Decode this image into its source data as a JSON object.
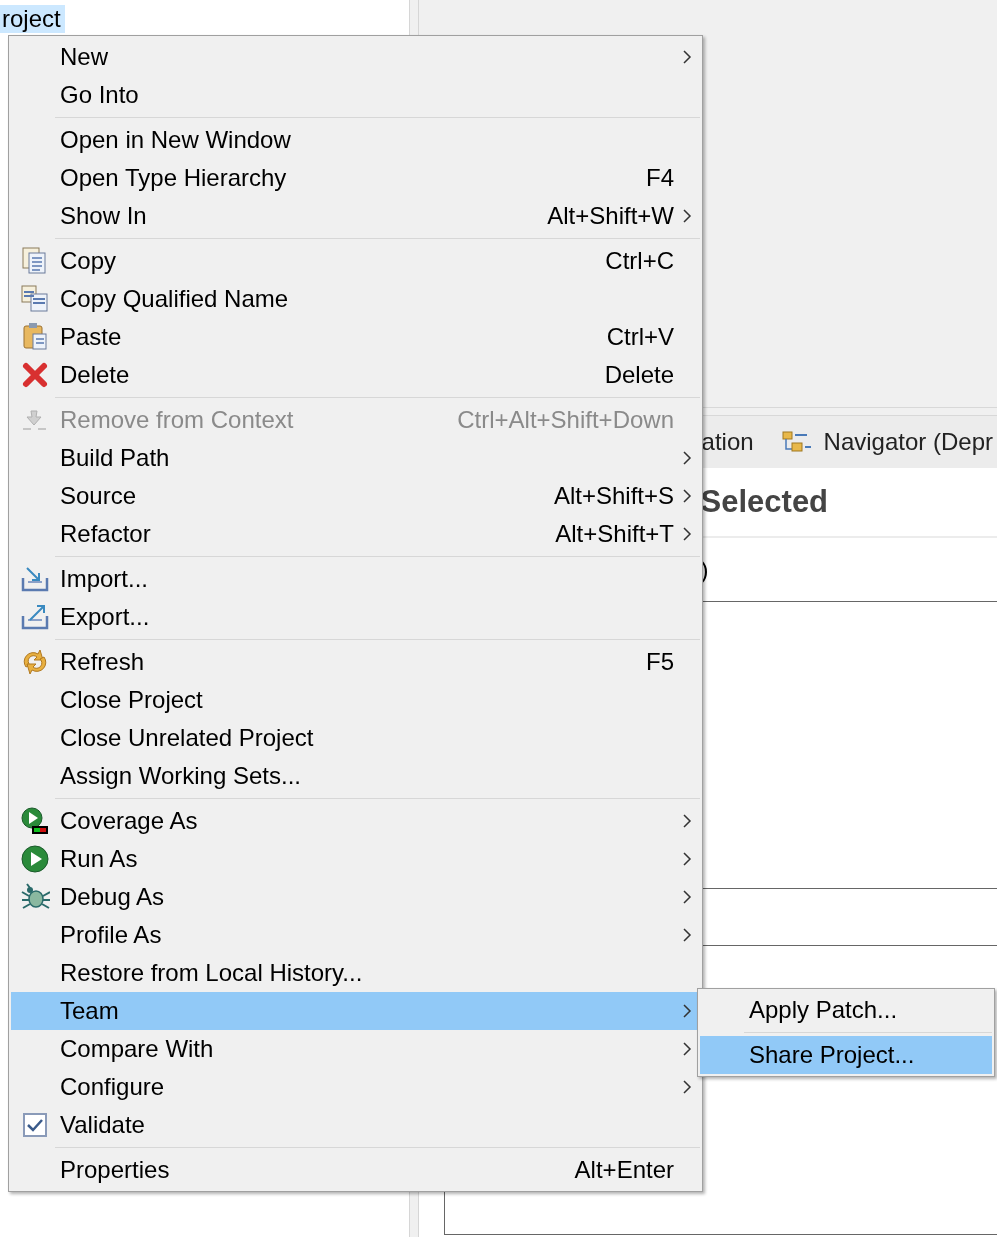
{
  "explorer": {
    "selected_item": {
      "label": "roject",
      "selected": true
    }
  },
  "editor": {
    "tabs": [
      {
        "label": "ation",
        "icon": false,
        "selected": false
      },
      {
        "label": "Navigator (Depr",
        "icon": true,
        "selected": false
      }
    ],
    "heading": "Selected",
    "line": ")"
  },
  "context_menu": {
    "groups": [
      [
        {
          "label": "New",
          "submenu": true
        },
        {
          "label": "Go Into"
        }
      ],
      [
        {
          "label": "Open in New Window"
        },
        {
          "label": "Open Type Hierarchy",
          "shortcut": "F4"
        },
        {
          "label": "Show In",
          "shortcut": "Alt+Shift+W",
          "submenu": true
        }
      ],
      [
        {
          "label": "Copy",
          "shortcut": "Ctrl+C",
          "kind": "copy"
        },
        {
          "label": "Copy Qualified Name",
          "kind": "copy2"
        },
        {
          "label": "Paste",
          "shortcut": "Ctrl+V",
          "kind": "paste"
        },
        {
          "label": "Delete",
          "shortcut": "Delete",
          "kind": "delete"
        }
      ],
      [
        {
          "label": "Remove from Context",
          "shortcut": "Ctrl+Alt+Shift+Down",
          "kind": "remove",
          "disabled": true
        },
        {
          "label": "Build Path",
          "submenu": true
        },
        {
          "label": "Source",
          "shortcut": "Alt+Shift+S",
          "submenu": true
        },
        {
          "label": "Refactor",
          "shortcut": "Alt+Shift+T",
          "submenu": true
        }
      ],
      [
        {
          "label": "Import...",
          "kind": "import"
        },
        {
          "label": "Export...",
          "kind": "export"
        }
      ],
      [
        {
          "label": "Refresh",
          "shortcut": "F5",
          "kind": "refresh"
        },
        {
          "label": "Close Project"
        },
        {
          "label": "Close Unrelated Project"
        },
        {
          "label": "Assign Working Sets..."
        }
      ],
      [
        {
          "label": "Coverage As",
          "submenu": true,
          "kind": "coverage"
        },
        {
          "label": "Run As",
          "submenu": true,
          "kind": "run"
        },
        {
          "label": "Debug As",
          "submenu": true,
          "kind": "bug"
        },
        {
          "label": "Profile As",
          "submenu": true
        },
        {
          "label": "Restore from Local History..."
        },
        {
          "label": "Team",
          "submenu": true,
          "selected": true
        },
        {
          "label": "Compare With",
          "submenu": true
        },
        {
          "label": "Configure",
          "submenu": true
        },
        {
          "label": "Validate",
          "kind": "check"
        }
      ],
      [
        {
          "label": "Properties",
          "shortcut": "Alt+Enter"
        }
      ]
    ]
  },
  "submenu": {
    "groups": [
      [
        {
          "label": "Apply Patch...",
          "selected": false
        }
      ],
      [
        {
          "label": "Share Project...",
          "selected": true
        }
      ]
    ]
  }
}
